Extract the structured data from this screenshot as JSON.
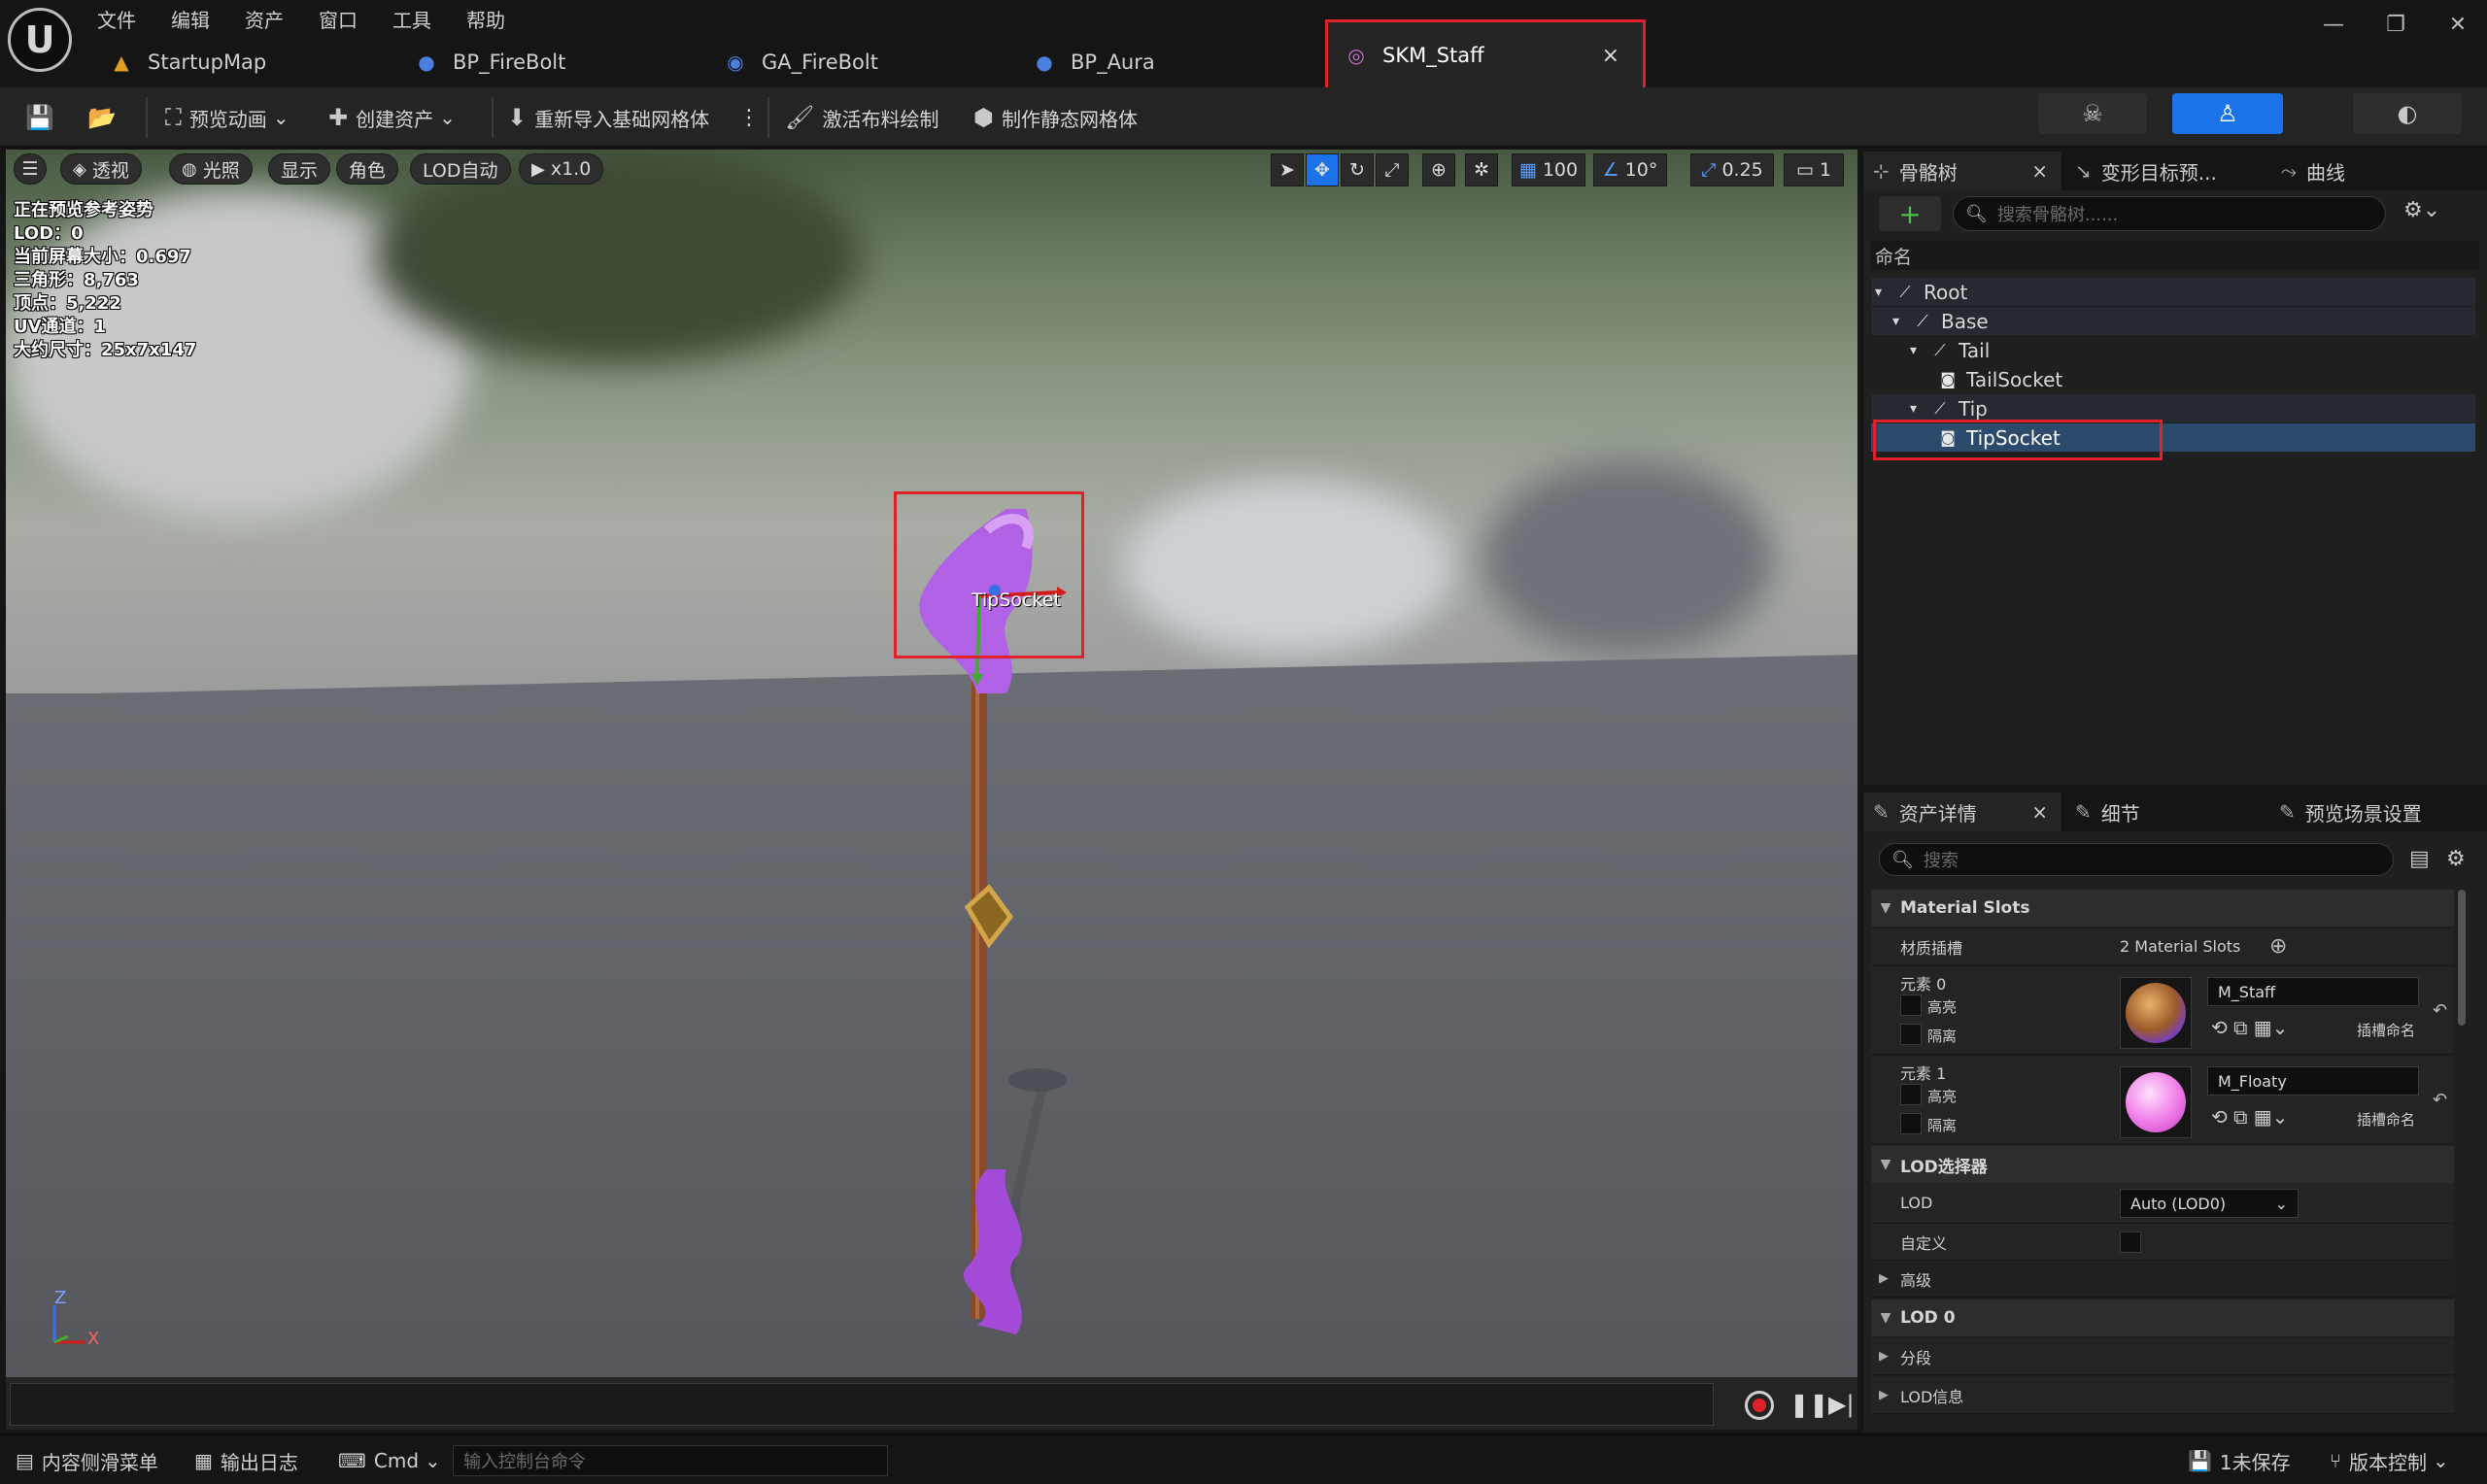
{
  "menu": {
    "items": [
      "文件",
      "编辑",
      "资产",
      "窗口",
      "工具",
      "帮助"
    ]
  },
  "window_controls": {
    "minimize": "—",
    "restore": "❐",
    "close": "✕"
  },
  "tabs": [
    {
      "label": "StartupMap",
      "icon": "level-icon"
    },
    {
      "label": "BP_FireBolt",
      "icon": "blueprint-icon"
    },
    {
      "label": "GA_FireBolt",
      "icon": "ability-icon"
    },
    {
      "label": "BP_Aura",
      "icon": "blueprint-icon"
    },
    {
      "label": "SKM_Staff",
      "icon": "skeletal-mesh-icon",
      "active": true,
      "close": "×"
    }
  ],
  "toolbar": {
    "preview_anim": "预览动画",
    "create_asset": "创建资产",
    "reimport": "重新导入基础网格体",
    "cloth_paint": "激活布料绘制",
    "make_static": "制作静态网格体"
  },
  "viewport": {
    "buttons": {
      "perspective": "透视",
      "lighting": "光照",
      "show": "显示",
      "character": "角色",
      "lod": "LOD自动",
      "play_speed": "x1.0"
    },
    "right_controls": {
      "grid": "100",
      "angle": "10°",
      "scale": "0.25",
      "camera": "1"
    },
    "stats": [
      "正在预览参考姿势",
      "LOD：0",
      "当前屏幕大小：0.697",
      "三角形：8,763",
      "顶点：5,222",
      "UV通道：1",
      "大约尺寸：25x7x147"
    ],
    "socket_label": "TipSocket",
    "axis": {
      "z": "Z",
      "x": "X"
    }
  },
  "skeleton_panel": {
    "tabs": [
      "骨骼树",
      "变形目标预...",
      "曲线"
    ],
    "tab_close": "×",
    "add_label": "+",
    "search_placeholder": "搜索骨骼树......",
    "column_header": "命名",
    "tree": [
      {
        "label": "Root",
        "type": "bone",
        "depth": 0
      },
      {
        "label": "Base",
        "type": "bone",
        "depth": 1
      },
      {
        "label": "Tail",
        "type": "bone",
        "depth": 2
      },
      {
        "label": "TailSocket",
        "type": "socket",
        "depth": 3
      },
      {
        "label": "Tip",
        "type": "bone",
        "depth": 2
      },
      {
        "label": "TipSocket",
        "type": "socket",
        "depth": 3,
        "selected": true
      }
    ]
  },
  "details_panel": {
    "tabs": [
      "资产详情",
      "细节",
      "预览场景设置"
    ],
    "tab_close": "×",
    "search_placeholder": "搜索",
    "material_slots_header": "Material Slots",
    "material_slots_label": "材质插槽",
    "material_slots_count": "2 Material Slots",
    "elements": [
      {
        "label": "元素 0",
        "highlight": "高亮",
        "isolate": "隔离",
        "material": "M_Staff",
        "slot_name": "插槽命名"
      },
      {
        "label": "元素 1",
        "highlight": "高亮",
        "isolate": "隔离",
        "material": "M_Floaty",
        "slot_name": "插槽命名"
      }
    ],
    "lod_picker_header": "LOD选择器",
    "lod_label": "LOD",
    "lod_value": "Auto (LOD0)",
    "custom_label": "自定义",
    "advanced_label": "高级",
    "lod0_header": "LOD 0",
    "sections_label": "分段",
    "lod_info_label": "LOD信息"
  },
  "statusbar": {
    "content_drawer": "内容侧滑菜单",
    "output_log": "输出日志",
    "cmd": "Cmd",
    "console_placeholder": "输入控制台命令",
    "unsaved": "1未保存",
    "source_control": "版本控制"
  },
  "colors": {
    "accent": "#1a73e8",
    "highlight_box": "#e0202a",
    "selected_row": "#2c4a6b"
  }
}
